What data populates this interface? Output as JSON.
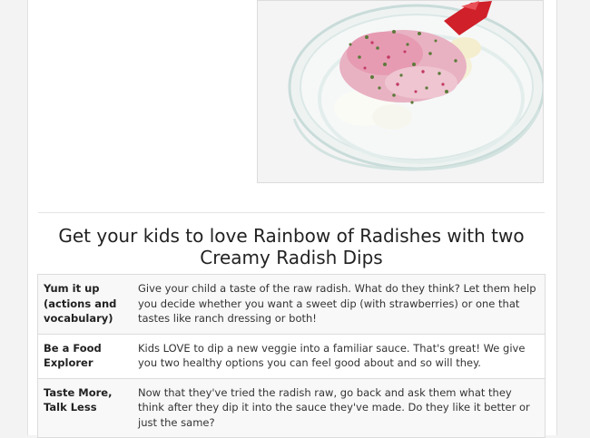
{
  "section": {
    "heading": "Get your kids to love Rainbow of Radishes with two Creamy Radish Dips"
  },
  "tips": [
    {
      "label": "Yum it up (actions and vocabulary)",
      "text": "Give your child a taste of the raw radish. What do they think? Let them help you decide whether you want a sweet dip (with strawberries) or one that tastes like ranch dressing or both!"
    },
    {
      "label": "Be a Food Explorer",
      "text": "Kids LOVE to dip a new veggie into a familiar sauce. That's great! We give you two healthy options you can feel good about and so will they."
    },
    {
      "label": "Taste More, Talk Less",
      "text": "Now that they've tried the radish raw, go back and ask them what they think after they dip it into the sauce they've made. Do they like it better or just the same?"
    }
  ],
  "colors": {
    "page_background": "#f3f3f3",
    "content_background": "#ffffff",
    "border": "#dcdcdc",
    "stripe": "#f8f8f8",
    "spatula_red": "#d0202a"
  }
}
